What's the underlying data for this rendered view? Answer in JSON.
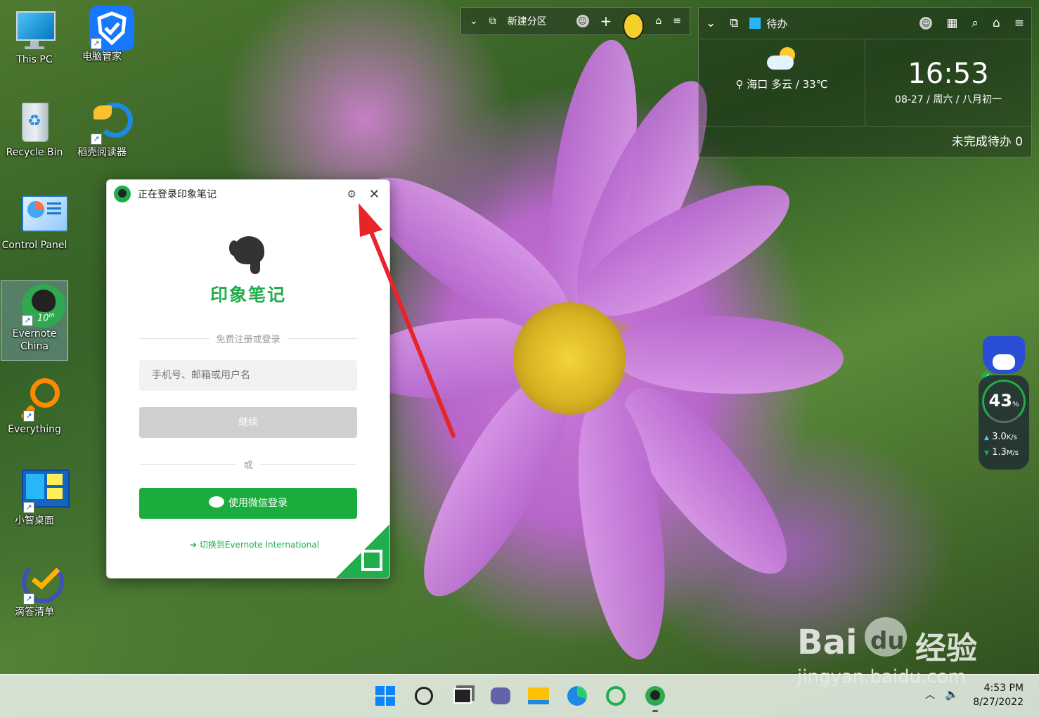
{
  "desktop": {
    "icons": [
      {
        "label": "This PC"
      },
      {
        "label": "电脑管家"
      },
      {
        "label": "Recycle Bin"
      },
      {
        "label": "稻壳阅读器"
      },
      {
        "label": "Control Panel"
      },
      {
        "label": "Evernote China"
      },
      {
        "label": "Everything"
      },
      {
        "label": "小智桌面"
      },
      {
        "label": "滴答清单"
      }
    ]
  },
  "fence": {
    "title": "新建分区"
  },
  "widget": {
    "tab": "待办",
    "weather": {
      "location": "海口",
      "condition": "多云 / 33℃"
    },
    "clock": {
      "time": "16:53",
      "date": "08-27 / 周六 / 八月初一"
    },
    "todo_status": "未完成待办 0"
  },
  "login": {
    "title": "正在登录印象笔记",
    "brand": "印象笔记",
    "divider_top": "免费注册或登录",
    "account_placeholder": "手机号、邮箱或用户名",
    "continue_label": "继续",
    "divider_or": "或",
    "wechat_label": "使用微信登录",
    "switch_label": "切换到Evernote International",
    "brand_color": "#1fae4b"
  },
  "net_monitor": {
    "percent": "43",
    "unit": "%",
    "up": "3.0",
    "up_unit": "K/s",
    "down": "1.3",
    "down_unit": "M/s"
  },
  "taskbar": {
    "time": "4:53 PM",
    "date": "8/27/2022"
  },
  "watermark": {
    "brand": "Bai",
    "brand2": "du",
    "suffix": "经验",
    "url": "jingyan.baidu.com"
  }
}
